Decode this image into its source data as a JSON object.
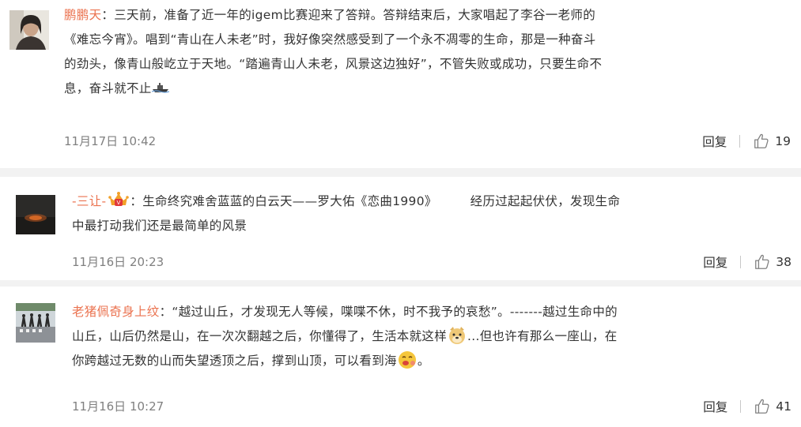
{
  "comments": [
    {
      "user": "鹏鹏天",
      "separator": "：",
      "text_lines": [
        "三天前，准备了近一年的igem比赛迎来了答辩。答辩结束后，大家唱起了李谷一老师的",
        "《难忘今宵》。唱到“青山在人未老”时，我好像突然感受到了一个永不凋零的生命，那是一种奋斗",
        "的劲头，像青山般屹立于天地。“踏遍青山人未老，风景这边独好”，不管失败或成功，只要生命不",
        "息，奋斗就不止"
      ],
      "emoji": "ship-emoji",
      "time": "11月17日 10:42",
      "reply_label": "回复",
      "likes": "19"
    },
    {
      "user": "-三让-",
      "badge": "crown-badge",
      "separator": "：",
      "text_part1": "生命终究难舍蓝蓝的白云天——罗大佑《恋曲1990》",
      "text_part2": "经历过起起伏伏，发现生命",
      "text_line2": "中最打动我们还是最简单的风景",
      "time": "11月16日 20:23",
      "reply_label": "回复",
      "likes": "38"
    },
    {
      "user": "老猪佩奇身上纹",
      "separator": "：",
      "line1": "“越过山丘，才发现无人等候，喋喋不休，时不我予的哀愁”。-------越过生命中的",
      "line2a": "山丘，山后仍然是山，在一次次翻越之后，你懂得了，生活本就这样",
      "line2b": "...但也许有那么一座山，在",
      "line3a": "你跨越过无数的山而失望透顶之后，撑到山顶，可以看到海",
      "line3b": "。",
      "emoji1": "doge-emoji",
      "emoji2": "hungry-face-emoji",
      "time": "11月16日 10:27",
      "reply_label": "回复",
      "likes": "41"
    }
  ],
  "colors": {
    "username": "#eb7350",
    "text": "#333333",
    "meta": "#808080",
    "background": "#f2f2f2"
  }
}
